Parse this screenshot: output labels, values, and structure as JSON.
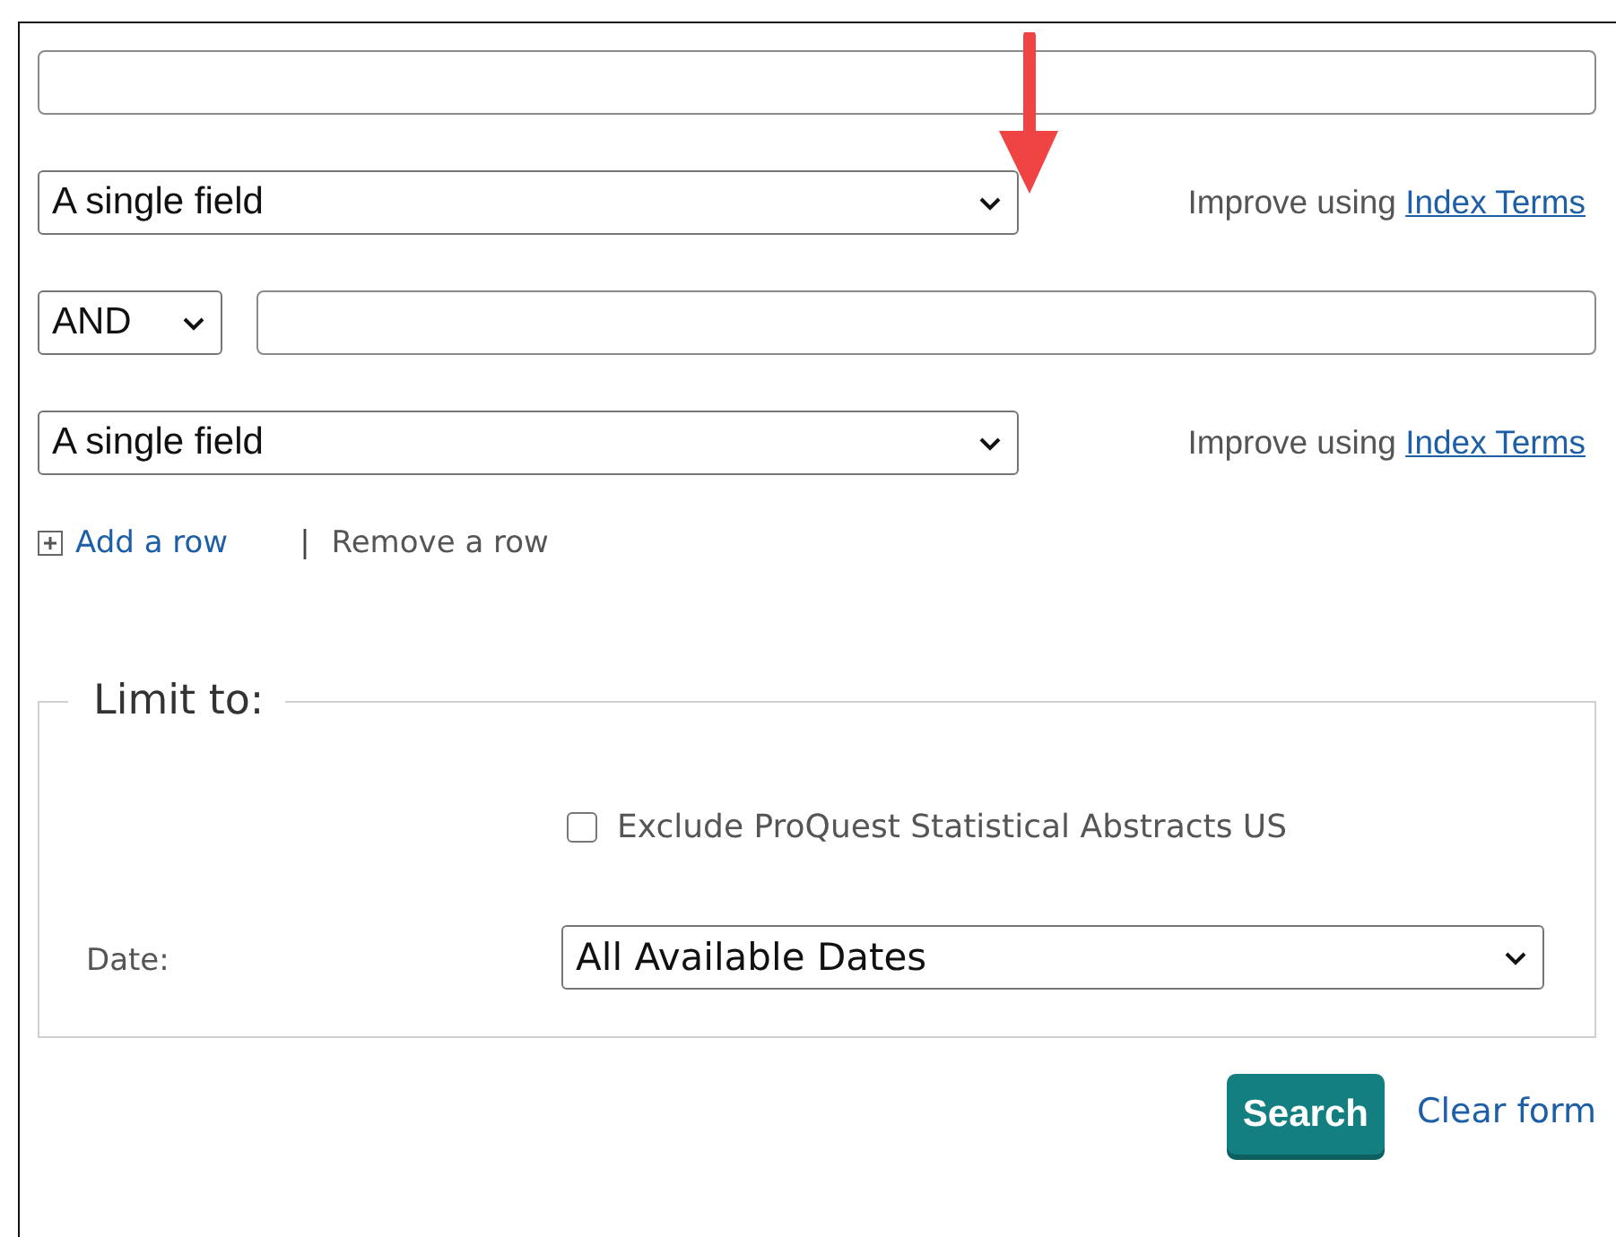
{
  "query_rows": [
    {
      "field": "A single field",
      "hint_label": "Improve using",
      "hint_link": "Index Terms"
    },
    {
      "operator": "AND",
      "field": "A single field",
      "hint_label": "Improve using",
      "hint_link": "Index Terms"
    }
  ],
  "row_actions_separator": "|",
  "row_actions": [
    {
      "kind": "add",
      "label": "Add a row"
    },
    {
      "kind": "remove",
      "label": "Remove a row"
    }
  ],
  "limit": {
    "legend": "Limit to:",
    "checkbox": {
      "label": "Exclude ProQuest Statistical Abstracts US",
      "checked": false
    },
    "date": {
      "label": "Date:",
      "value": "All Available Dates"
    }
  },
  "buttons": {
    "search": "Search",
    "clear": "Clear form"
  }
}
